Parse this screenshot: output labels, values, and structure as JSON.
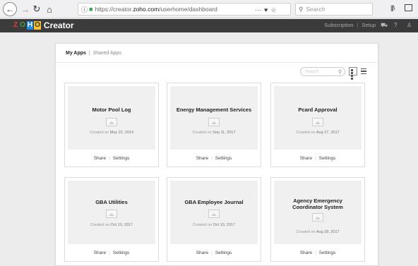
{
  "browser": {
    "url_prefix": "https://creator.",
    "url_host": "zoho.com",
    "url_path": "/userhome/dashboard",
    "more_icon": "···",
    "search_placeholder": "Search"
  },
  "header": {
    "logo_letters": [
      "Z",
      "O",
      "H",
      "O"
    ],
    "app_name": "Creator",
    "links": [
      "Subscription",
      "Setup"
    ],
    "icons": [
      "cart-icon",
      "help-icon",
      "user-icon"
    ]
  },
  "tabs": {
    "active": "My Apps",
    "separator": "|",
    "other": "Shared Apps"
  },
  "search": {
    "placeholder": "Search"
  },
  "cards": [
    {
      "title": "Motor Pool Log",
      "created_label": "Created on",
      "created_date": "May 23, 2014",
      "share": "Share",
      "settings": "Settings"
    },
    {
      "title": "Energy Management Services",
      "created_label": "Created on",
      "created_date": "Sep 11, 2017",
      "share": "Share",
      "settings": "Settings"
    },
    {
      "title": "Pcard Approval",
      "created_label": "Created on",
      "created_date": "Aug 27, 2017",
      "share": "Share",
      "settings": "Settings"
    },
    {
      "title": "GBA Utilities",
      "created_label": "Created on",
      "created_date": "Oct 10, 2017",
      "share": "Share",
      "settings": "Settings"
    },
    {
      "title": "GBA Employee Journal",
      "created_label": "Created on",
      "created_date": "Oct 10, 2017",
      "share": "Share",
      "settings": "Settings"
    },
    {
      "title": "Agency Emergency Coordinator System",
      "created_label": "Created on",
      "created_date": "Aug 28, 2017",
      "share": "Share",
      "settings": "Settings"
    }
  ]
}
